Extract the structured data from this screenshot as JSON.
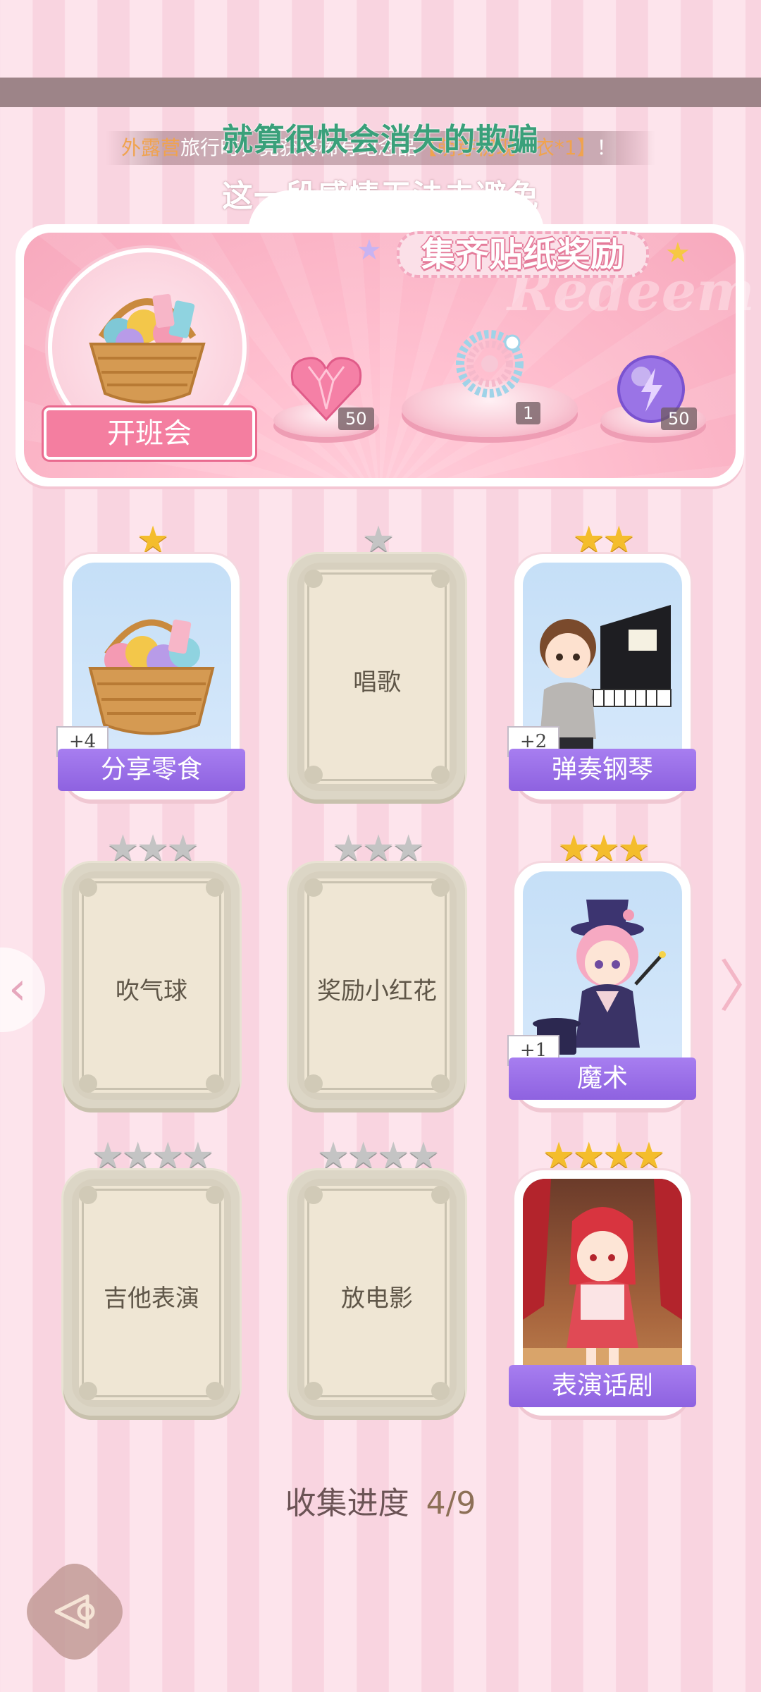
{
  "lyrics": {
    "line1": "就算很快会消失的欺骗",
    "line2": "这一段感情无法去避免"
  },
  "notice": {
    "prefix": "外露营",
    "middle": "旅行时，竟获得稀有纪念品",
    "item": "【萌芽初现 · 衣*1】",
    "suffix": "！"
  },
  "banner": {
    "title": "集齐贴纸奖励",
    "watermark": "Redeem",
    "event_label": "开班会",
    "rewards": [
      {
        "icon": "pink-heart-gem-icon",
        "qty": "50"
      },
      {
        "icon": "pearl-bracelet-icon",
        "qty": "1"
      },
      {
        "icon": "purple-energy-orb-icon",
        "qty": "50"
      }
    ]
  },
  "cards": [
    {
      "name": "分享零食",
      "stars": 1,
      "unlocked": true,
      "bonus": "+4",
      "art": "snack-basket-icon"
    },
    {
      "name": "唱歌",
      "stars": 1,
      "unlocked": false
    },
    {
      "name": "弹奏钢琴",
      "stars": 2,
      "unlocked": true,
      "bonus": "+2",
      "art": "piano-boy-icon"
    },
    {
      "name": "吹气球",
      "stars": 3,
      "unlocked": false
    },
    {
      "name": "奖励小红花",
      "stars": 3,
      "unlocked": false
    },
    {
      "name": "魔术",
      "stars": 3,
      "unlocked": true,
      "bonus": "+1",
      "art": "magician-girl-icon"
    },
    {
      "name": "吉他表演",
      "stars": 4,
      "unlocked": false
    },
    {
      "name": "放电影",
      "stars": 4,
      "unlocked": false
    },
    {
      "name": "表演话剧",
      "stars": 4,
      "unlocked": true,
      "art": "red-hood-girl-icon"
    }
  ],
  "progress": {
    "label": "收集进度",
    "value": "4/9",
    "fraction": 0.444
  },
  "nav": {
    "left_arrow": "‹",
    "right_arrow": "〉"
  },
  "colors": {
    "accent_purple": "#9a6fea",
    "gold_star": "#f4bd2c",
    "banner_pink": "#f7a9bd"
  }
}
